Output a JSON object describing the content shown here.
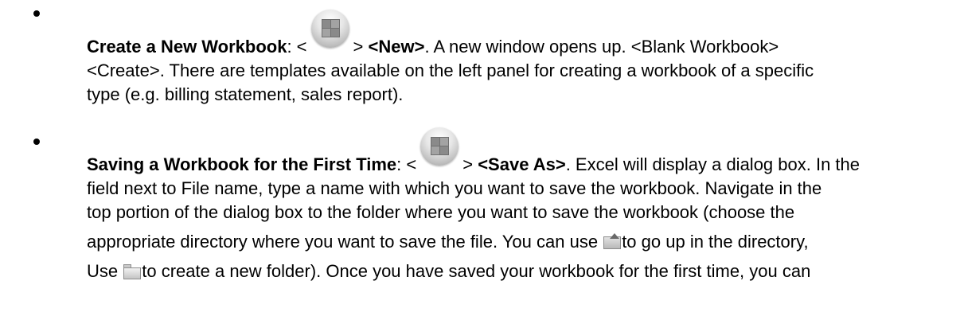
{
  "document": {
    "items": [
      {
        "title": "Create a New Workbook",
        "colon": ": <",
        "after_button": "> ",
        "menu": "<New>",
        "line1_rest": ". A new window opens up. <Blank Workbook>",
        "line2": "<Create>. There are templates available on the left panel for creating a workbook of a specific",
        "line3": "type (e.g. billing statement, sales report)."
      },
      {
        "title": "Saving a Workbook for the First Time",
        "colon": ": <",
        "after_button": "> ",
        "menu": "<Save As>",
        "line1_rest": ". Excel will display a dialog box. In the",
        "line2": "field next to File name, type a name with which you want to save the workbook. Navigate in the",
        "line3": "top portion of the dialog box to the folder where you want to save the workbook (choose the",
        "line4_a": "appropriate directory where you want to save the file. You can use ",
        "line4_b": "to go up in the directory,",
        "line5_a": "Use ",
        "line5_b": "to create a new folder). Once you have saved your workbook for the first time, you can"
      }
    ],
    "icons": {
      "office_button": "office-button-icon",
      "up_one_level": "up-one-level-icon",
      "new_folder": "new-folder-icon"
    }
  }
}
